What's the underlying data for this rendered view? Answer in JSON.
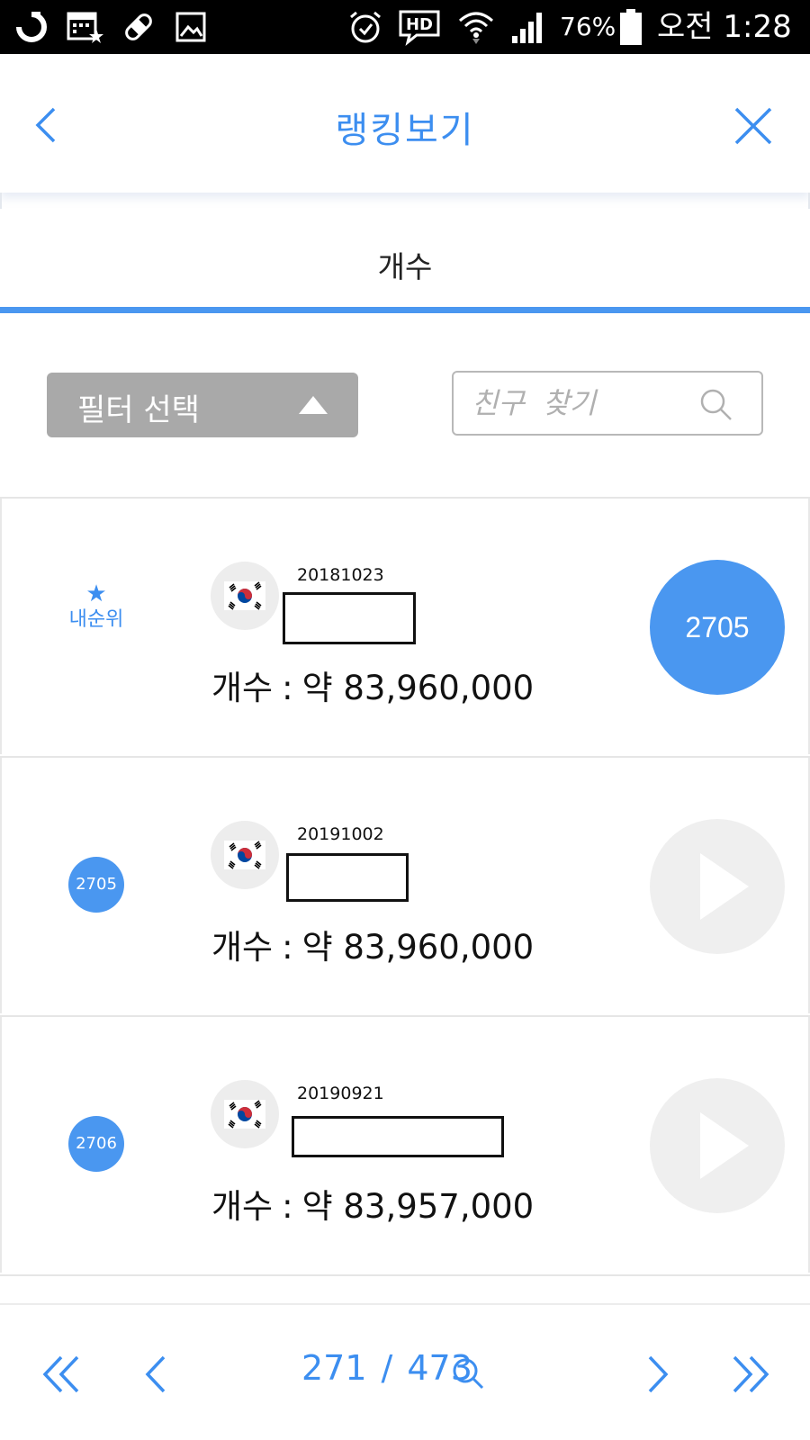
{
  "status_bar": {
    "battery": "76%",
    "time": "오전 1:28",
    "icons": [
      "o-app-icon",
      "calendar-star-icon",
      "bandage-icon",
      "image-icon",
      "alarm-icon",
      "hd-voice-icon",
      "wifi-icon",
      "signal-icon",
      "battery-icon"
    ]
  },
  "header": {
    "title": "랭킹보기",
    "back_icon": "chevron-left-icon",
    "close_icon": "close-icon"
  },
  "tab": {
    "label": "개수"
  },
  "filter": {
    "label": "필터 선택",
    "icon": "triangle-up-icon"
  },
  "search": {
    "placeholder": "친구  찾기",
    "icon": "search-icon"
  },
  "my_rank": {
    "star": "★",
    "label": "내순위"
  },
  "rows": [
    {
      "rank": "2705",
      "date": "20181023",
      "count_label": "개수",
      "count_sep": ":",
      "count_value": "약 83,960,000",
      "is_mine": true
    },
    {
      "rank": "2705",
      "date": "20191002",
      "count_label": "개수",
      "count_sep": ":",
      "count_value": "약 83,960,000",
      "is_mine": false
    },
    {
      "rank": "2706",
      "date": "20190921",
      "count_label": "개수",
      "count_sep": ":",
      "count_value": "약 83,957,000",
      "is_mine": false
    }
  ],
  "pagination": {
    "current": "271",
    "separator": "/",
    "total": "473"
  },
  "colors": {
    "accent": "#3c8ef0",
    "badge": "#4a97f0",
    "filter_bg": "#a9a9a9",
    "play_bg": "#efefef"
  }
}
